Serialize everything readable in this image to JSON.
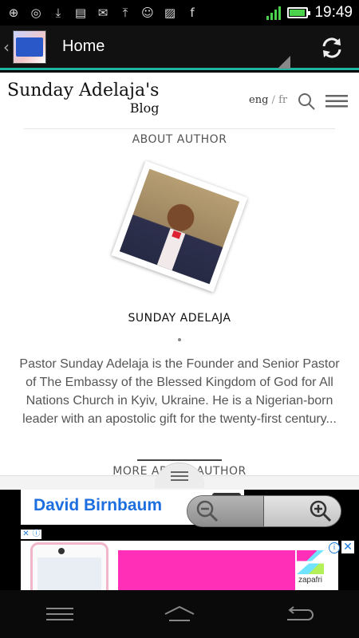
{
  "status_bar": {
    "time": "19:49",
    "battery_level": 0.85,
    "notification_icons": [
      "add-icon",
      "whatsapp-icon",
      "download-icon",
      "message-icon",
      "gmail-icon",
      "upload-icon",
      "add-person-icon",
      "image-icon",
      "facebook-icon"
    ]
  },
  "action_bar": {
    "title": "Home"
  },
  "blog": {
    "title_line1": "Sunday Adelaja's",
    "title_line2": "Blog",
    "lang_current": "eng",
    "lang_separator": "/",
    "lang_other": "fr"
  },
  "author_section": {
    "heading": "ABOUT AUTHOR",
    "name": "SUNDAY ADELAJA",
    "bio": "Pastor Sunday Adelaja is the Founder and Senior Pastor of The Embassy of the Blessed Kingdom of God for All Nations Church in Kyiv, Ukraine. He is a Nigerian-born leader with an apostolic gift for the twenty-first century...",
    "more_link": "MORE ABOUT AUTHOR"
  },
  "ads": {
    "banner1_text": "David Birnbaum",
    "banner2_brand": "zapafri"
  },
  "colors": {
    "accent": "#1fb3a3",
    "ad_link": "#1d6fe0",
    "ad_pink": "#ff2fb8"
  }
}
